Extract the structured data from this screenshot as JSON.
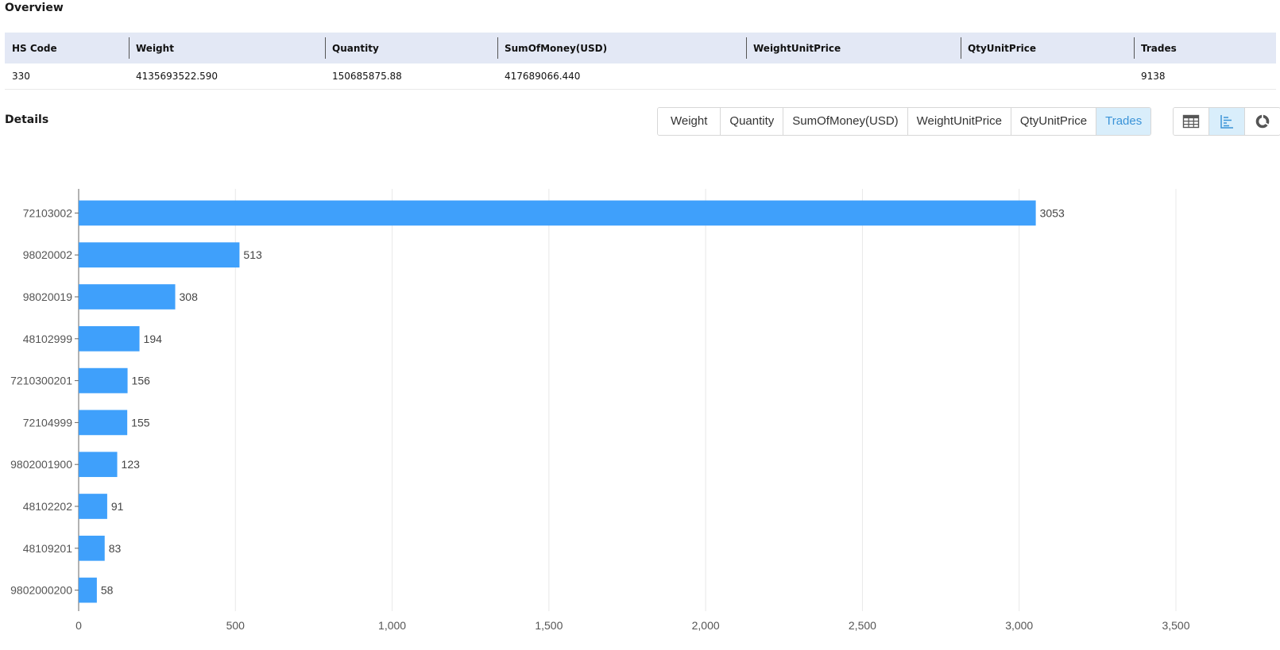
{
  "overview": {
    "title": "Overview",
    "headers": [
      "HS Code",
      "Weight",
      "Quantity",
      "SumOfMoney(USD)",
      "WeightUnitPrice",
      "QtyUnitPrice",
      "Trades"
    ],
    "row": [
      "330",
      "4135693522.590",
      "150685875.88",
      "417689066.440",
      "",
      "",
      "9138"
    ]
  },
  "details": {
    "title": "Details",
    "metric_tabs": [
      "Weight",
      "Quantity",
      "SumOfMoney(USD)",
      "WeightUnitPrice",
      "QtyUnitPrice",
      "Trades"
    ],
    "active_metric": "Trades",
    "view_tabs": [
      {
        "icon": "table-icon"
      },
      {
        "icon": "bar-chart-icon"
      },
      {
        "icon": "pie-chart-icon"
      }
    ],
    "active_view": "bar-chart-icon"
  },
  "colors": {
    "bar": "#3fa0fb",
    "accent": "#3a93d8",
    "header_bg": "#e3e8f5",
    "gridline": "#e8e8e8"
  },
  "chart_data": {
    "type": "bar",
    "orientation": "horizontal",
    "categories": [
      "72103002",
      "98020002",
      "98020019",
      "48102999",
      "7210300201",
      "72104999",
      "9802001900",
      "48102202",
      "48109201",
      "9802000200"
    ],
    "values": [
      3053,
      513,
      308,
      194,
      156,
      155,
      123,
      91,
      83,
      58
    ],
    "x_ticks": [
      0,
      500,
      1000,
      1500,
      2000,
      2500,
      3000,
      3500
    ],
    "x_tick_labels": [
      "0",
      "500",
      "1,000",
      "1,500",
      "2,000",
      "2,500",
      "3,000",
      "3,500"
    ],
    "xlim": [
      0,
      3500
    ],
    "grid": true,
    "data_labels": true
  }
}
